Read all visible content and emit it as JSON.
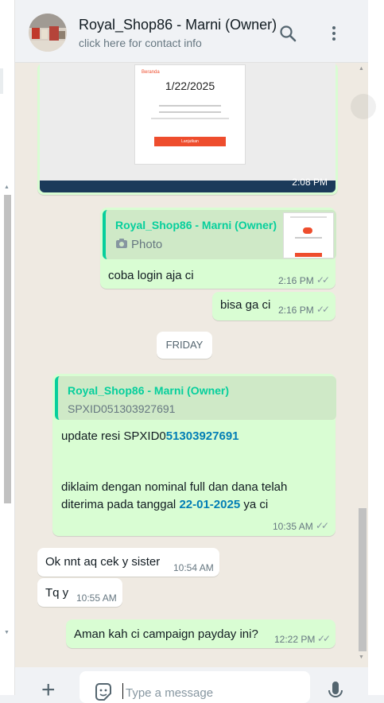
{
  "header": {
    "contact_name": "Royal_Shop86 - Marni (Owner)",
    "contact_sub": "click here for contact info",
    "search_icon": "search-icon",
    "menu_icon": "menu-icon"
  },
  "messages": {
    "image_msg": {
      "time": "2:08 PM",
      "card_date": "1/22/2025",
      "card_button": "Lanjutkan",
      "card_brand": "Beranda"
    },
    "reply1": {
      "quote_name": "Royal_Shop86 - Marni (Owner)",
      "quote_label": "Photo",
      "text": "coba login aja ci",
      "time": "2:16 PM"
    },
    "msg2": {
      "text": "bisa ga ci",
      "time": "2:16 PM"
    },
    "date_chip": "FRIDAY",
    "reply2": {
      "quote_name": "Royal_Shop86 - Marni (Owner)",
      "quote_text": "SPXID051303927691",
      "line1_prefix": "update resi SPXID0",
      "line1_link": "51303927691",
      "line2": "diklaim dengan nominal full dan dana telah",
      "line3_prefix": "diterima pada tanggal ",
      "line3_link": "22-01-2025",
      "line3_suffix": " ya ci",
      "time": "10:35 AM"
    },
    "in1": {
      "text": "Ok nnt aq cek y sister",
      "time": "10:54 AM"
    },
    "in2": {
      "text": "Tq y",
      "time": "10:55 AM"
    },
    "out_last": {
      "text": "Aman kah ci campaign payday ini?",
      "time": "12:22 PM"
    }
  },
  "footer": {
    "input_placeholder": "Type a message"
  },
  "colors": {
    "outgoing_bubble": "#d9fdd3",
    "incoming_bubble": "#ffffff",
    "chat_background": "#efeae2",
    "quote_accent": "#06cf9c",
    "link": "#027eb5"
  }
}
